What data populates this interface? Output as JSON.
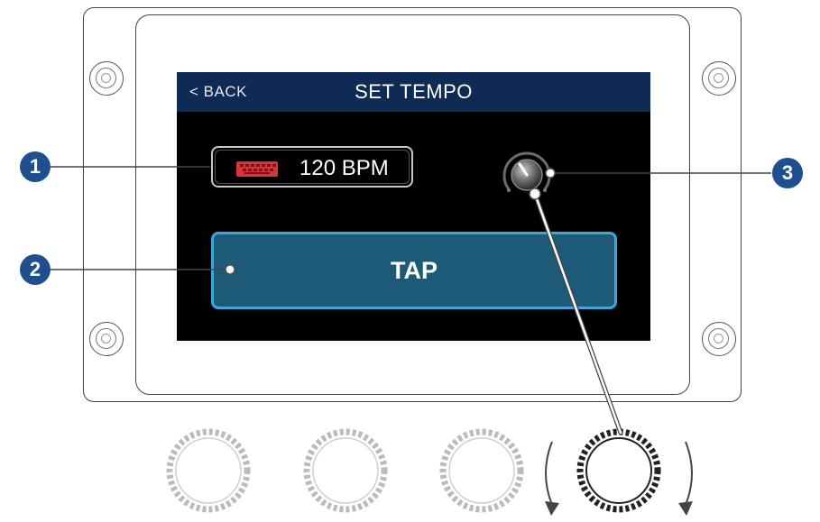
{
  "header": {
    "back_label": "< BACK",
    "title": "SET TEMPO"
  },
  "tempo": {
    "value_label": "120 BPM",
    "input_icon": "keyboard-icon"
  },
  "tap_button": {
    "label": "TAP"
  },
  "callouts": [
    "1",
    "2",
    "3"
  ],
  "colors": {
    "header_bg": "#0e2a55",
    "screen_bg": "#000000",
    "tap_fill": "#1d5a78",
    "tap_border": "#3ea7d9",
    "keyboard_icon": "#d8343a",
    "callout_bg": "#1f4f8f"
  }
}
